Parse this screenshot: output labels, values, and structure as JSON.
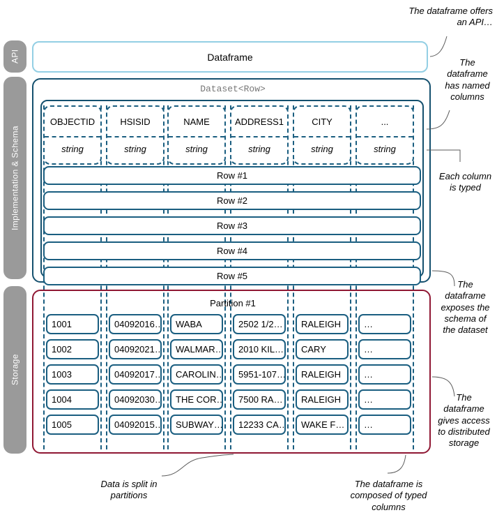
{
  "layers": [
    {
      "id": "api",
      "label": "API"
    },
    {
      "id": "impl",
      "label": "Implementation & Schema"
    },
    {
      "id": "storage",
      "label": "Storage"
    }
  ],
  "api": {
    "box_label": "Dataframe",
    "border_color": "#93cfe4"
  },
  "implementation": {
    "dataset_label": "Dataset<Row>",
    "border_color": "#14506e"
  },
  "schema": {
    "columns": [
      {
        "name": "OBJECTID",
        "type": "string"
      },
      {
        "name": "HSISID",
        "type": "string"
      },
      {
        "name": "NAME",
        "type": "string"
      },
      {
        "name": "ADDRESS1",
        "type": "string"
      },
      {
        "name": "CITY",
        "type": "string"
      },
      {
        "name": "...",
        "type": "string"
      }
    ]
  },
  "rows": [
    {
      "label": "Row #1"
    },
    {
      "label": "Row #2"
    },
    {
      "label": "Row #3"
    },
    {
      "label": "Row #4"
    },
    {
      "label": "Row #5"
    }
  ],
  "storage": {
    "partition_label": "Partition #1",
    "border_color": "#8f1733",
    "data": [
      [
        "1001",
        "04092016…",
        "WABA",
        "2502 1/2…",
        "RALEIGH",
        "…"
      ],
      [
        "1002",
        "04092021…",
        "WALMAR…",
        "2010 KIL…",
        "CARY",
        "…"
      ],
      [
        "1003",
        "04092017…",
        "CAROLIN…",
        "5951-107…",
        "RALEIGH",
        "…"
      ],
      [
        "1004",
        "04092030…",
        "THE COR…",
        "7500 RA…",
        "RALEIGH",
        "…"
      ],
      [
        "1005",
        "04092015…",
        "SUBWAY…",
        "12233 CA…",
        "WAKE F…",
        "…"
      ]
    ]
  },
  "annotations": {
    "api_offer": "The dataframe offers\nan API…",
    "named_columns": "The\ndataframe\nhas named\ncolumns",
    "each_typed": "Each column\nis typed",
    "exposes_schema": "The\ndataframe\nexposes the\nschema of\nthe dataset",
    "distributed": "The\ndataframe\ngives access\nto distributed\nstorage",
    "split": "Data is split in\npartitions",
    "typed_columns": "The dataframe is\ncomposed of typed\ncolumns"
  }
}
